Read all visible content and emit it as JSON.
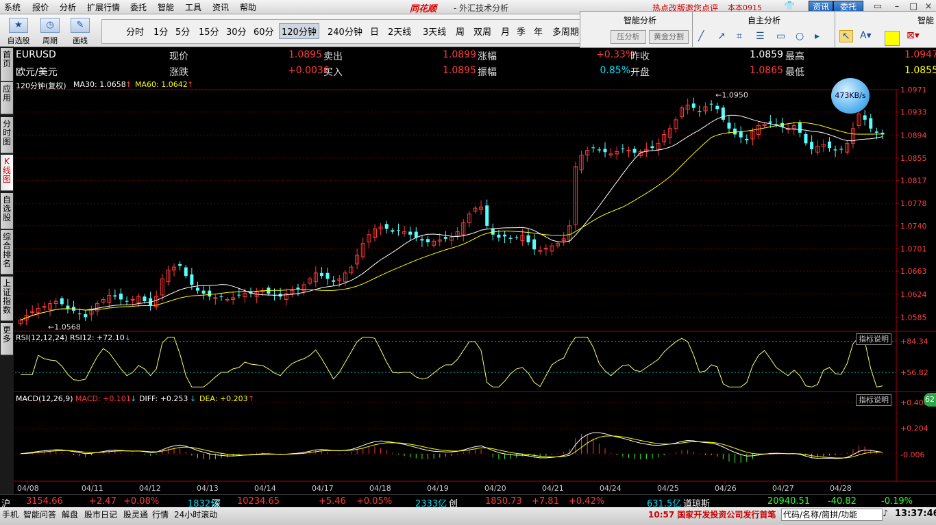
{
  "menu": [
    "系统",
    "报价",
    "分析",
    "扩展行情",
    "委托",
    "智能",
    "工具",
    "资讯",
    "帮助"
  ],
  "window": {
    "logo": "同花顺",
    "title": "- 外汇技术分析",
    "hot_link": "热点改版邀您点评",
    "version": "本本0915",
    "btn_news": "资讯",
    "btn_trade": "委托"
  },
  "toolbar": {
    "watchlist": "自选股",
    "cycle": "周期",
    "draw": "画线"
  },
  "periods": [
    "分时",
    "1分",
    "5分",
    "15分",
    "30分",
    "60分",
    "120分钟",
    "240分钟",
    "日",
    "2天线",
    "3天线",
    "周",
    "双周",
    "月",
    "季",
    "年",
    "多周期"
  ],
  "active_period": "120分钟",
  "smart_panel": {
    "title": "智能分析",
    "btn1": "压分析",
    "btn2": "黄金分割"
  },
  "self_panel": {
    "title": "自主分析"
  },
  "right_panel": {
    "title": "智能"
  },
  "left_tabs": [
    "首页",
    "应用",
    "分时图",
    "K线图",
    "自选股",
    "综合排名",
    "上证指数",
    "更多"
  ],
  "quote": {
    "symbol": "EURUSD",
    "name": "欧元/美元",
    "rows": [
      [
        {
          "label": "现价",
          "value": "1.0895",
          "color": "red"
        },
        {
          "label": "卖出",
          "value": "1.0899",
          "color": "red"
        },
        {
          "label": "涨幅",
          "value": "+0.33%",
          "color": "red"
        },
        {
          "label": "昨收",
          "value": "1.0859",
          "color": "white"
        },
        {
          "label": "最高",
          "value": "1.0947",
          "color": "red"
        }
      ],
      [
        {
          "label": "涨跌",
          "value": "+0.0036",
          "color": "red"
        },
        {
          "label": "买入",
          "value": "1.0895",
          "color": "red"
        },
        {
          "label": "振幅",
          "value": "0.85%",
          "color": "cyan"
        },
        {
          "label": "开盘",
          "value": "1.0865",
          "color": "red"
        },
        {
          "label": "最低",
          "value": "1.0855",
          "color": "yellow"
        }
      ]
    ]
  },
  "main_indicator": {
    "name": "120分钟(复权)",
    "ma30": "MA30: 1.0658",
    "ma60": "MA60: 1.0642"
  },
  "rsi": {
    "name": "RSI(12,12,24)",
    "value": "RSI12: +72.10",
    "explain": "指标说明",
    "upper": "+84.34",
    "lower": "+56.82"
  },
  "macd": {
    "name": "MACD(12,26,9)",
    "macd": "MACD: +0.101",
    "diff": "DIFF: +0.253",
    "dea": "DEA: +0.203",
    "explain": "指标说明",
    "ticks": [
      "+0.409",
      "+0.204",
      "-0.006"
    ]
  },
  "badge": "62",
  "speed": "473KB/s",
  "chart_data": {
    "type": "candlestick",
    "instrument": "EURUSD",
    "period": "120分钟",
    "y_ticks": [
      "1.0971",
      "1.0933",
      "1.0894",
      "1.0855",
      "1.0817",
      "1.0778",
      "1.0740",
      "1.0701",
      "1.0663",
      "1.0624",
      "1.0585"
    ],
    "ylim": [
      1.0561,
      1.0971
    ],
    "x_ticks": [
      "04/08",
      "04/11",
      "04/12",
      "04/13",
      "04/14",
      "04/17",
      "04/18",
      "04/19",
      "04/20",
      "04/21",
      "04/24",
      "04/25",
      "04/26",
      "04/27",
      "04/28"
    ],
    "max_label": "1.0950",
    "min_label": "1.0568",
    "close_path": [
      1.058,
      1.0588,
      1.0595,
      1.06,
      1.0603,
      1.0608,
      1.0612,
      1.0607,
      1.06,
      1.0596,
      1.059,
      1.0585,
      1.0598,
      1.0608,
      1.0615,
      1.0622,
      1.062,
      1.0615,
      1.0612,
      1.0615,
      1.062,
      1.0612,
      1.0605,
      1.062,
      1.065,
      1.0665,
      1.067,
      1.0672,
      1.0655,
      1.064,
      1.063,
      1.0625,
      1.062,
      1.0618,
      1.062,
      1.0615,
      1.0618,
      1.0622,
      1.0625,
      1.0625,
      1.0628,
      1.063,
      1.0625,
      1.0622,
      1.062,
      1.0625,
      1.063,
      1.0632,
      1.064,
      1.065,
      1.066,
      1.0655,
      1.065,
      1.0645,
      1.065,
      1.066,
      1.067,
      1.069,
      1.071,
      1.0725,
      1.0735,
      1.0738,
      1.0735,
      1.073,
      1.0732,
      1.073,
      1.0725,
      1.072,
      1.0715,
      1.0712,
      1.0714,
      1.0716,
      1.0718,
      1.072,
      1.073,
      1.0745,
      1.076,
      1.077,
      1.0772,
      1.074,
      1.0725,
      1.072,
      1.0722,
      1.0718,
      1.072,
      1.0724,
      1.0712,
      1.07,
      1.0698,
      1.0702,
      1.0706,
      1.071,
      1.0718,
      1.074,
      1.084,
      1.086,
      1.0868,
      1.0872,
      1.0868,
      1.0865,
      1.0862,
      1.0866,
      1.087,
      1.0868,
      1.0864,
      1.0866,
      1.087,
      1.0872,
      1.088,
      1.0895,
      1.0905,
      1.092,
      1.094,
      1.0945,
      1.094,
      1.0935,
      1.0942,
      1.0946,
      1.0938,
      1.092,
      1.0905,
      1.0895,
      1.089,
      1.0885,
      1.09,
      1.091,
      1.0912,
      1.0915,
      1.0912,
      1.0908,
      1.0905,
      1.091,
      1.0898,
      1.088,
      1.087,
      1.0875,
      1.0878,
      1.0872,
      1.0868,
      1.087,
      1.088,
      1.0905,
      1.093,
      1.092,
      1.0905,
      1.0898,
      1.0895
    ],
    "rsi_ylim": [
      40,
      92
    ],
    "macd_ylim": [
      -0.22,
      0.48
    ]
  },
  "ticker": [
    {
      "text": "沪",
      "color": "white"
    },
    {
      "text": "3154.66",
      "color": "red"
    },
    {
      "text": "+2.47",
      "color": "red"
    },
    {
      "text": "+0.08%",
      "color": "red"
    },
    {
      "text": "1832亿",
      "color": "cyan"
    },
    {
      "text": "深",
      "color": "white"
    },
    {
      "text": "10234.65",
      "color": "red"
    },
    {
      "text": "+5.46",
      "color": "red"
    },
    {
      "text": "+0.05%",
      "color": "red"
    },
    {
      "text": "2333亿",
      "color": "cyan"
    },
    {
      "text": "创",
      "color": "white"
    },
    {
      "text": "1850.73",
      "color": "red"
    },
    {
      "text": "+7.81",
      "color": "red"
    },
    {
      "text": "+0.42%",
      "color": "red"
    },
    {
      "text": "631.5亿",
      "color": "cyan"
    },
    {
      "text": "道琼斯",
      "color": "white"
    },
    {
      "text": "20940.51",
      "color": "green"
    },
    {
      "text": "-40.82",
      "color": "green"
    },
    {
      "text": "-0.19%",
      "color": "green"
    }
  ],
  "statusbar": {
    "items": [
      "手机",
      "智能问答",
      "解盘",
      "股市日记",
      "股灵通",
      "行情",
      "24小时滚动"
    ],
    "news": "10:57 国家开发投资公司发行首笔",
    "search": "代码/名称/简拼/功能",
    "clock": "13:37:46"
  }
}
